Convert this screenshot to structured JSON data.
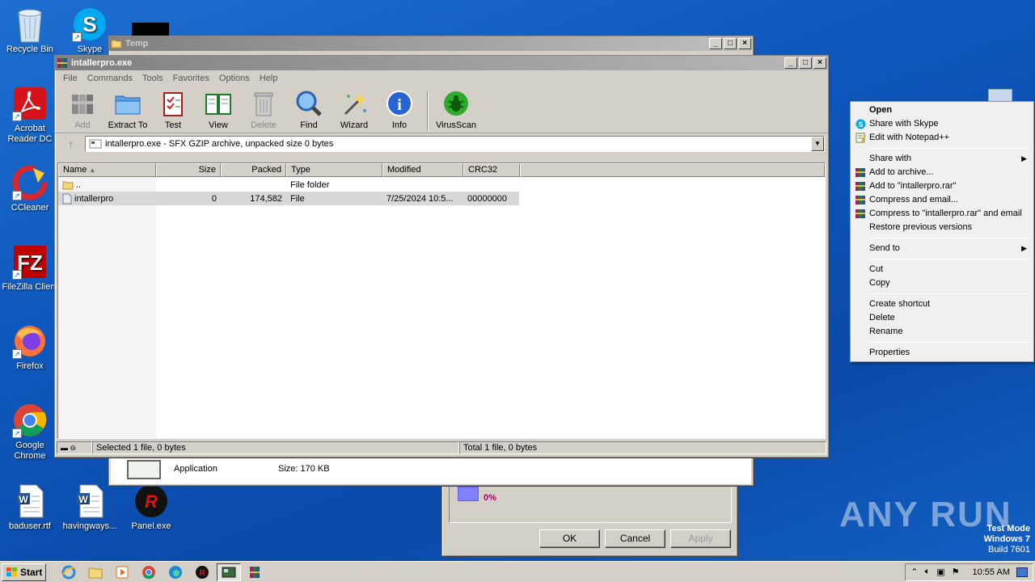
{
  "desktop": {
    "icons": [
      {
        "label": "Recycle Bin"
      },
      {
        "label": "Skype"
      },
      {
        "label": "Acrobat Reader DC"
      },
      {
        "label": "CCleaner"
      },
      {
        "label": "FileZilla Client"
      },
      {
        "label": "Firefox"
      },
      {
        "label": "Google Chrome"
      },
      {
        "label": "baduser.rtf"
      },
      {
        "label": "havingways..."
      },
      {
        "label": "Panel.exe"
      }
    ],
    "watermark": {
      "brand": "ANY RUN",
      "mode": "Test Mode",
      "os": "Windows 7",
      "build": "Build 7601"
    }
  },
  "temp_window": {
    "title": "Temp",
    "file_type": "Application",
    "file_size": "Size: 170 KB"
  },
  "props_dialog": {
    "percent": "0%",
    "ok": "OK",
    "cancel": "Cancel",
    "apply": "Apply"
  },
  "winrar": {
    "title": "intallerpro.exe",
    "menu": [
      "File",
      "Commands",
      "Tools",
      "Favorites",
      "Options",
      "Help"
    ],
    "toolbar": [
      {
        "label": "Add",
        "icon": "add-icon",
        "enabled": false
      },
      {
        "label": "Extract To",
        "icon": "extract-folder-icon",
        "enabled": true
      },
      {
        "label": "Test",
        "icon": "test-clipboard-icon",
        "enabled": true
      },
      {
        "label": "View",
        "icon": "view-book-icon",
        "enabled": true
      },
      {
        "label": "Delete",
        "icon": "trash-icon",
        "enabled": false
      },
      {
        "label": "Find",
        "icon": "magnifier-icon",
        "enabled": true
      },
      {
        "label": "Wizard",
        "icon": "wand-icon",
        "enabled": true
      },
      {
        "label": "Info",
        "icon": "info-icon",
        "enabled": true
      },
      {
        "label": "VirusScan",
        "icon": "bug-icon",
        "enabled": true
      }
    ],
    "address": "intallerpro.exe - SFX GZIP archive, unpacked size 0 bytes",
    "columns": [
      "Name",
      "Size",
      "Packed",
      "Type",
      "Modified",
      "CRC32"
    ],
    "rows": [
      {
        "name": "..",
        "size": "",
        "packed": "",
        "type": "File folder",
        "modified": "",
        "crc": ""
      },
      {
        "name": "intallerpro",
        "size": "0",
        "packed": "174,582",
        "type": "File",
        "modified": "7/25/2024 10:5...",
        "crc": "00000000"
      }
    ],
    "status_left": "Selected 1 file, 0 bytes",
    "status_right": "Total 1 file, 0 bytes"
  },
  "context_menu": {
    "items": [
      {
        "label": "Open",
        "bold": true
      },
      {
        "label": "Share with Skype",
        "icon": "skype-icon"
      },
      {
        "label": "Edit with Notepad++",
        "icon": "notepadpp-icon"
      },
      {
        "sep": true
      },
      {
        "label": "Share with",
        "submenu": true
      },
      {
        "label": "Add to archive...",
        "icon": "winrar-icon"
      },
      {
        "label": "Add to \"intallerpro.rar\"",
        "icon": "winrar-icon"
      },
      {
        "label": "Compress and email...",
        "icon": "winrar-icon"
      },
      {
        "label": "Compress to \"intallerpro.rar\" and email",
        "icon": "winrar-icon"
      },
      {
        "label": "Restore previous versions"
      },
      {
        "sep": true
      },
      {
        "label": "Send to",
        "submenu": true
      },
      {
        "sep": true
      },
      {
        "label": "Cut"
      },
      {
        "label": "Copy"
      },
      {
        "sep": true
      },
      {
        "label": "Create shortcut"
      },
      {
        "label": "Delete"
      },
      {
        "label": "Rename"
      },
      {
        "sep": true
      },
      {
        "label": "Properties"
      }
    ]
  },
  "taskbar": {
    "start": "Start",
    "clock": "10:55 AM"
  },
  "colors": {
    "desktop": "#1060c8",
    "window_face": "#d4d0c8",
    "selection": "#d8d8d8"
  }
}
